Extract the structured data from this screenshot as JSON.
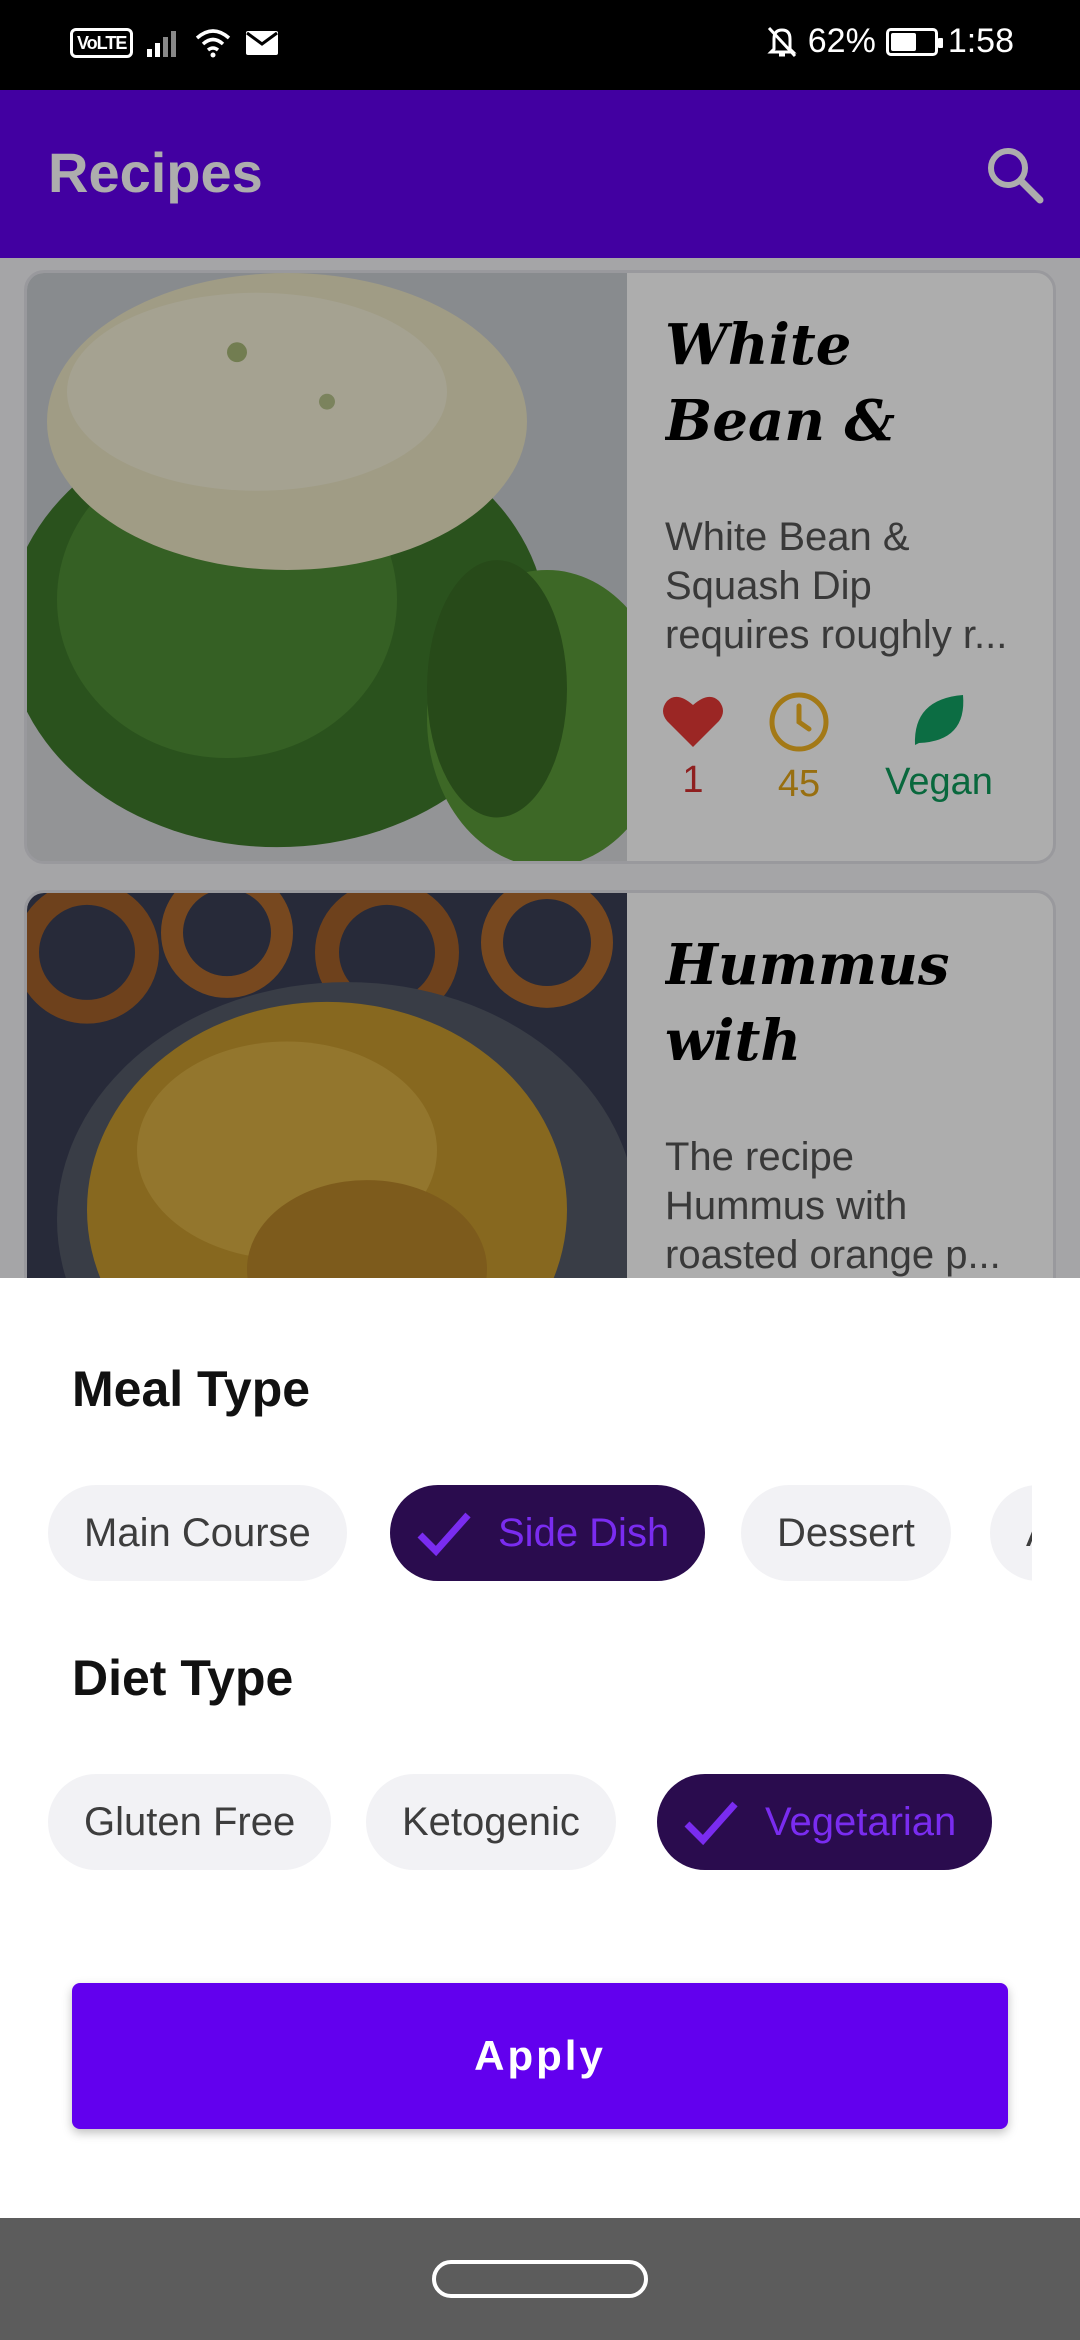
{
  "status_bar": {
    "volte": "VoLTE",
    "battery": "62%",
    "time": "1:58",
    "battery_level": 0.62
  },
  "app_bar": {
    "title": "Recipes"
  },
  "recipes": [
    {
      "title": "White Bean & Squash Dip",
      "description": "White Bean & Squash Dip requires roughly r...",
      "likes": "1",
      "minutes": "45",
      "diet": "Vegan"
    },
    {
      "title": "Hummus with roaste...",
      "description": "The recipe Hummus with roasted orange p..."
    }
  ],
  "filter_sheet": {
    "meal_type_title": "Meal Type",
    "meal_types": [
      "Main Course",
      "Side Dish",
      "Dessert",
      "A"
    ],
    "meal_type_selected": "Side Dish",
    "diet_type_title": "Diet Type",
    "diet_types": [
      "Gluten Free",
      "Ketogenic",
      "Vegetarian"
    ],
    "diet_type_selected": "Vegetarian",
    "apply_label": "Apply"
  },
  "colors": {
    "primary": "#6200ee",
    "chip_selected_bg": "#2a0c4e",
    "chip_selected_text": "#7a2cf0",
    "like": "#d32f2f",
    "time": "#e0a419",
    "vegan": "#0e9a5b"
  }
}
